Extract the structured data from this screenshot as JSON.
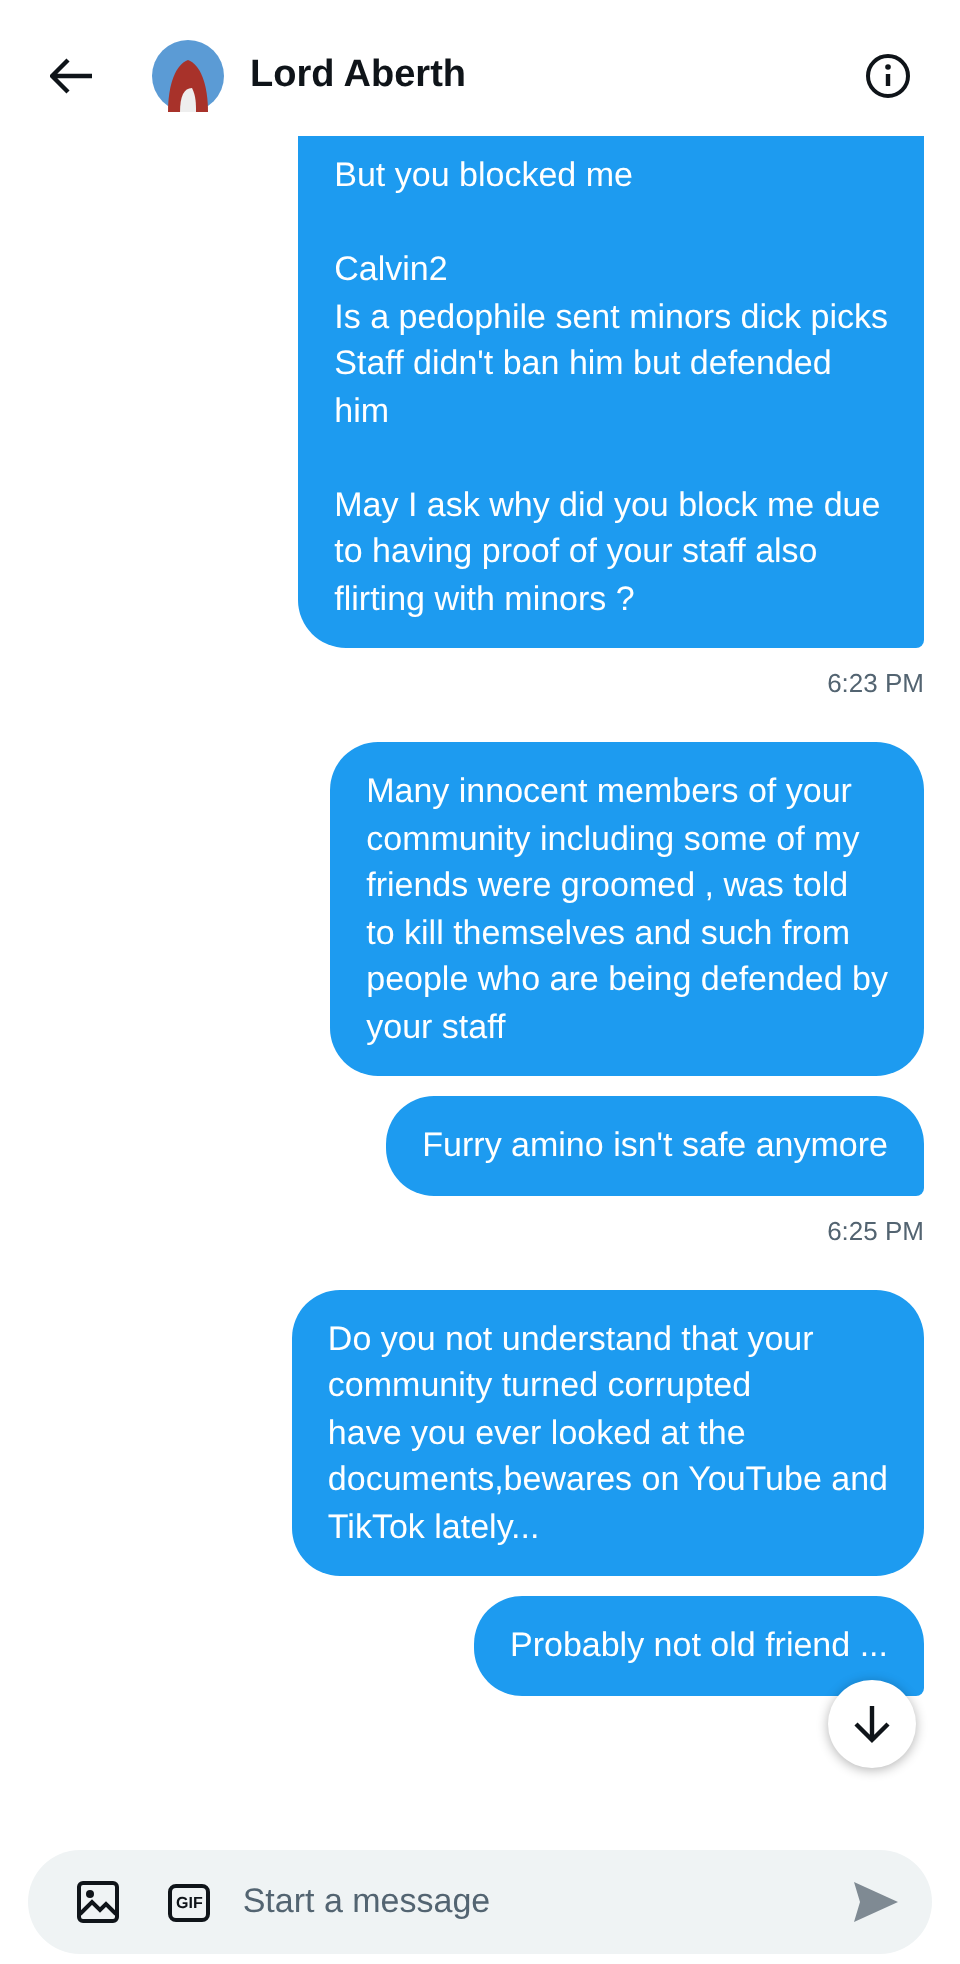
{
  "header": {
    "name": "Lord Aberth"
  },
  "groups": [
    {
      "messages": [
        "But you blocked me\n\nCalvin2\nIs a pedophile sent minors dick picks\nStaff didn't ban him but defended\nhim\n\nMay I ask why did you block me due\nto having proof of your staff also\nflirting with minors ?"
      ],
      "time": "6:23 PM"
    },
    {
      "messages": [
        "Many innocent members of your\ncommunity including some of my\nfriends were groomed , was told\nto kill themselves and such from\npeople who are being defended by\nyour staff",
        "Furry amino isn't safe anymore"
      ],
      "time": "6:25 PM"
    },
    {
      "messages": [
        "Do you not understand that your\ncommunity turned corrupted\nhave you ever looked at the\ndocuments,bewares on YouTube and\nTikTok lately...",
        "Probably not old friend ..."
      ]
    }
  ],
  "composer": {
    "gif_label": "GIF",
    "placeholder": "Start a message"
  }
}
